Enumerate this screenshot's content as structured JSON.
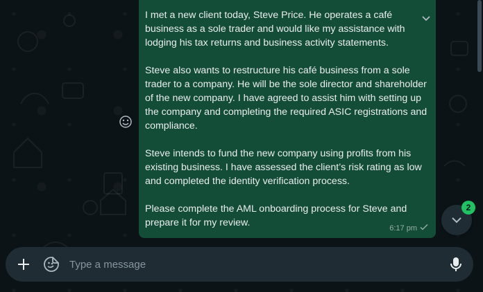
{
  "message": {
    "paragraphs": [
      "I met a new client today, Steve Price. He operates a café business as a sole trader and would like my assistance with lodging his tax returns and business activity statements.",
      "Steve also wants to restructure his café business from a sole trader to a company. He will be the sole director and shareholder of the new company. I have agreed to assist him with setting up the company and completing the required ASIC registrations and compliance.",
      "Steve intends to fund the new company using profits from his existing business. I have assessed the client’s risk rating as low and completed the identity verification process.",
      "Please complete the AML onboarding process for Steve and prepare it for my review."
    ],
    "time": "6:17 pm",
    "status_icon": "single-check-icon"
  },
  "scroll_down": {
    "unread_count": "2",
    "icon": "chevron-down-icon"
  },
  "composer": {
    "placeholder": "Type a message",
    "attach_icon": "plus-icon",
    "sticker_icon": "sticker-icon",
    "mic_icon": "microphone-icon"
  },
  "colors": {
    "outgoing_bubble": "#144d37",
    "background": "#0c1317",
    "composer": "#1f2c33",
    "badge": "#21c063",
    "text": "#e9edef"
  }
}
